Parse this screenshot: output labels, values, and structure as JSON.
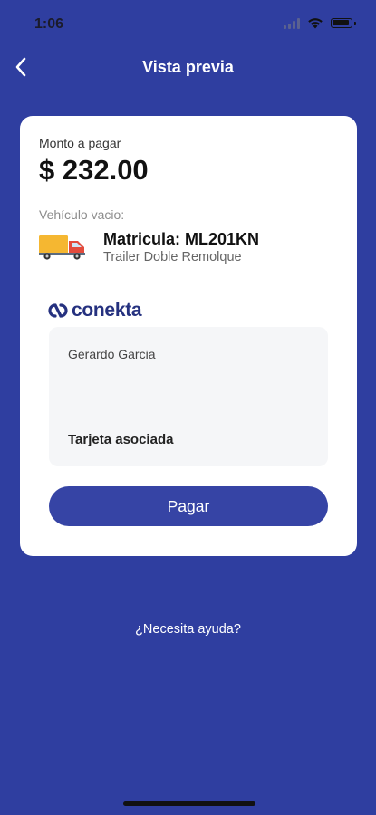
{
  "status_bar": {
    "time": "1:06"
  },
  "nav": {
    "title": "Vista previa",
    "back_icon": "chevron-left-icon"
  },
  "payment": {
    "amount_label": "Monto a pagar",
    "amount": "$ 232.00",
    "vehicle_label": "Vehículo vacio:",
    "plate": "Matricula: ML201KN",
    "vehicle_type": "Trailer Doble Remolque",
    "vehicle_icon": "truck-icon"
  },
  "provider": {
    "name": "conekta",
    "brand_color": "#25317f"
  },
  "card": {
    "holder": "Gerardo Garcia",
    "status": "Tarjeta asociada"
  },
  "actions": {
    "pay_label": "Pagar"
  },
  "help": {
    "label": "¿Necesita ayuda?"
  },
  "colors": {
    "background": "#2f3ea0",
    "button": "#3644a5",
    "truck_body": "#f5b731"
  }
}
